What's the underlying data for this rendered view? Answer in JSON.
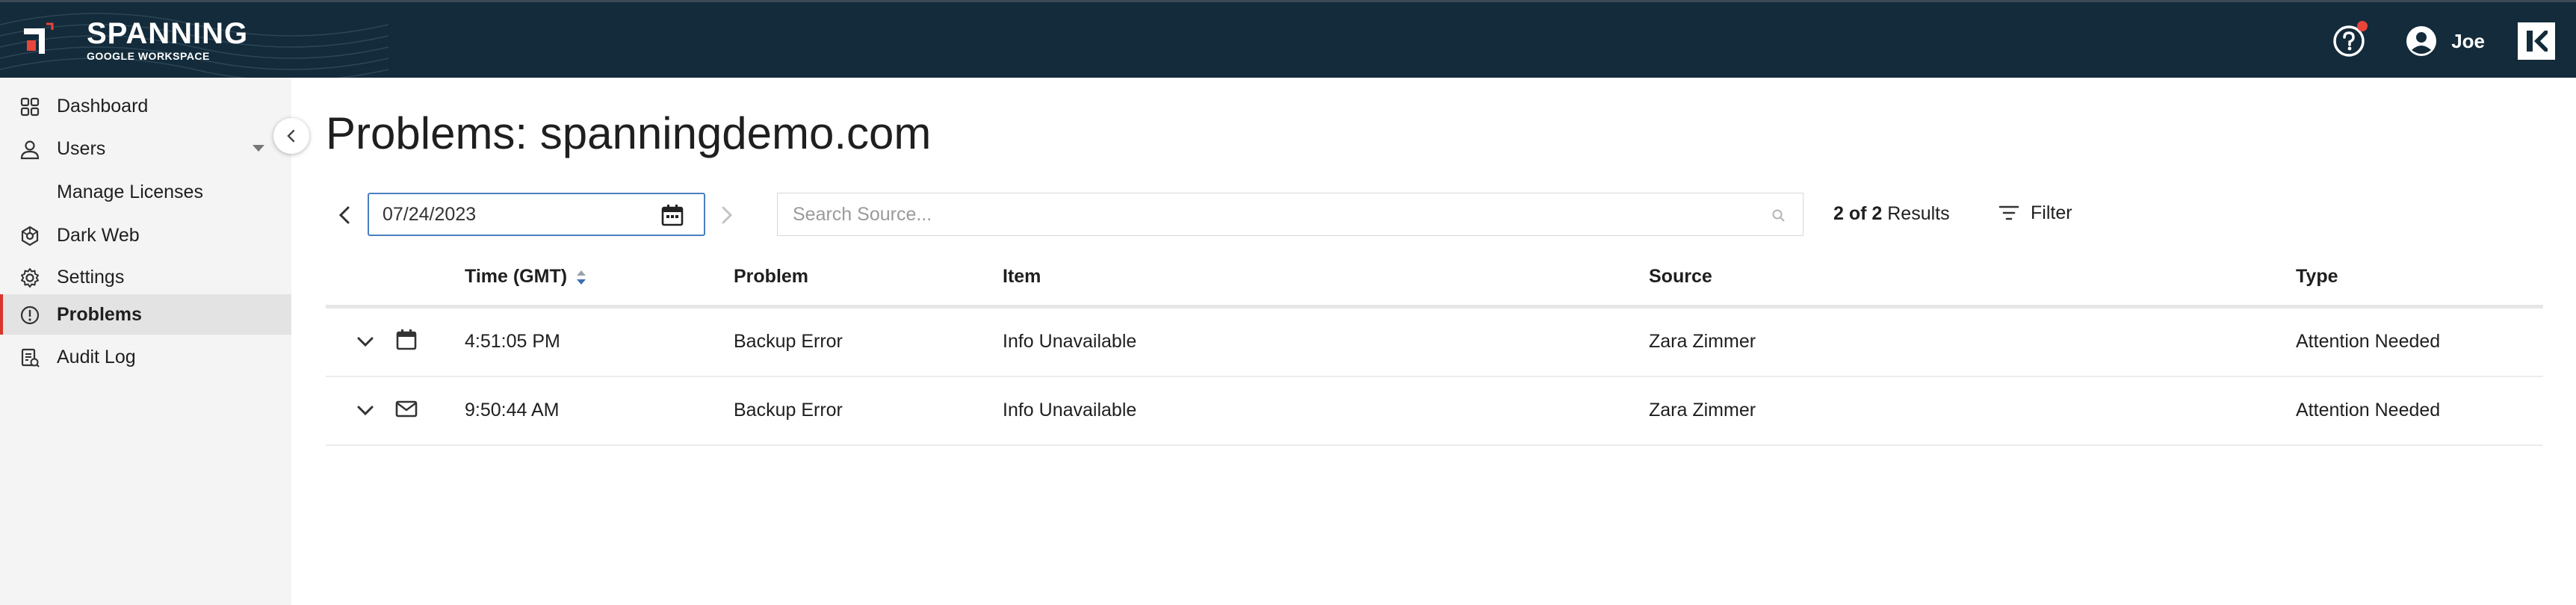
{
  "header": {
    "brand_title": "SPANNING",
    "brand_subtitle": "GOOGLE WORKSPACE",
    "user_name": "Joe",
    "icons": [
      "help-icon",
      "account-icon",
      "kaseya-logo-icon"
    ],
    "colors": {
      "bar": "#132b3a",
      "accent_red": "#e8453c"
    }
  },
  "sidebar": {
    "items": [
      {
        "label": "Dashboard",
        "icon": "dashboard-icon"
      },
      {
        "label": "Users",
        "icon": "user-icon"
      },
      {
        "label": "Manage Licenses"
      },
      {
        "label": "Dark Web",
        "icon": "dark-web-icon"
      },
      {
        "label": "Settings",
        "icon": "gear-icon"
      },
      {
        "label": "Problems",
        "icon": "info-icon",
        "active": true
      },
      {
        "label": "Audit Log",
        "icon": "audit-log-icon"
      }
    ]
  },
  "main": {
    "title": "Problems: spanningdemo.com",
    "date_value": "07/24/2023",
    "search_placeholder": "Search Source...",
    "results_count": "2 of 2",
    "results_label": "Results",
    "filter_label": "Filter",
    "columns": [
      "Time (GMT)",
      "Problem",
      "Item",
      "Source",
      "Type"
    ],
    "rows": [
      {
        "kind_icon": "calendar-icon",
        "time": "4:51:05 PM",
        "problem": "Backup Error",
        "item": "Info Unavailable",
        "source": "Zara Zimmer",
        "type": "Attention Needed"
      },
      {
        "kind_icon": "mail-icon",
        "time": "9:50:44 AM",
        "problem": "Backup Error",
        "item": "Info Unavailable",
        "source": "Zara Zimmer",
        "type": "Attention Needed"
      }
    ]
  }
}
